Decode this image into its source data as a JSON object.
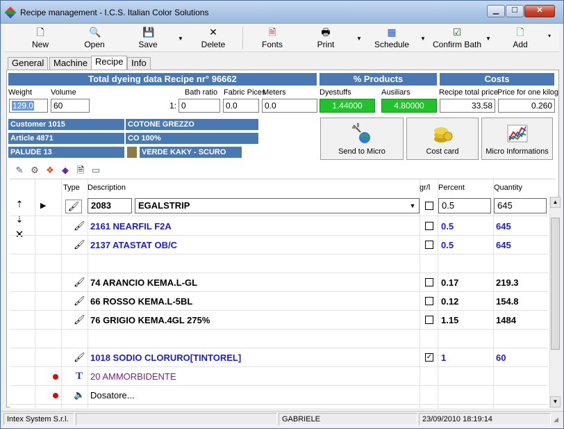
{
  "window": {
    "title": "Recipe management - I.C.S. Italian Color Solutions"
  },
  "toolbar": {
    "new": "New",
    "open": "Open",
    "save": "Save",
    "delete": "Delete",
    "fonts": "Fonts",
    "print": "Print",
    "schedule": "Schedule",
    "confirm_bath": "Confirm Bath",
    "add": "Add"
  },
  "tabs": [
    "General",
    "Machine",
    "Recipe",
    "Info"
  ],
  "headers": {
    "total": "Total dyeing data Recipe nr° 96662",
    "products": "% Products",
    "costs": "Costs"
  },
  "fields": {
    "weight_label": "Weight",
    "weight": "129.0",
    "volume_label": "Volume",
    "volume": "60",
    "bath_ratio_label": "Bath ratio",
    "bath_ratio_prefix": "1:",
    "bath_ratio": "0",
    "fabric_pieces_label": "Fabric Pices",
    "fabric_pieces": "0.0",
    "meters_label": "Meters",
    "meters": "0.0",
    "dyestuffs_label": "Dyestuffs",
    "dyestuffs": "1.44000",
    "ausiliars_label": "Ausiliars",
    "ausiliars": "4.80000",
    "recipe_total_price_label": "Recipe total price",
    "recipe_total_price": "33.58",
    "price_per_kg_label": "Price for one kilog",
    "price_per_kg": "0.260"
  },
  "info": {
    "customer": "Customer 1015",
    "customer_value": "COTONE GREZZO",
    "article": "Article 4871",
    "article_value": "CO 100%",
    "color": "PALUDE 13",
    "color_value": "VERDE KAKY - SCURO",
    "swatch_color": "#8b7b4a"
  },
  "actions": {
    "send_to_micro": "Send to Micro",
    "cost_card": "Cost card",
    "micro_informations": "Micro Informations"
  },
  "grid": {
    "headers": {
      "type": "Type",
      "description": "Description",
      "grl": "gr/l",
      "percent": "Percent",
      "quantity": "Quantity"
    },
    "edit_row": {
      "code": "2083",
      "name": "EGALSTRIP",
      "percent": "0.5",
      "quantity": "645"
    },
    "rows": [
      {
        "desc": "2161 NEARFIL F2A",
        "percent": "0.5",
        "quantity": "645",
        "checked": false,
        "color": "blue"
      },
      {
        "desc": "2137 ATASTAT OB/C",
        "percent": "0.5",
        "quantity": "645",
        "checked": false,
        "color": "blue"
      },
      {
        "desc": "74 ARANCIO KEMA.L-GL",
        "percent": "0.17",
        "quantity": "219.3",
        "checked": false,
        "color": "black"
      },
      {
        "desc": "66 ROSSO KEMA.L-5BL",
        "percent": "0.12",
        "quantity": "154.8",
        "checked": false,
        "color": "black"
      },
      {
        "desc": "76 GRIGIO KEMA.4GL 275%",
        "percent": "1.15",
        "quantity": "1484",
        "checked": false,
        "color": "black"
      },
      {
        "desc": "1018 SODIO CLORURO[TINTOREL]",
        "percent": "1",
        "quantity": "60",
        "checked": true,
        "color": "blue"
      },
      {
        "desc": "20 AMMORBIDENTE",
        "color": "purple"
      },
      {
        "desc": "Dosatore...",
        "color": "black"
      }
    ]
  },
  "status": {
    "company": "Intex System S.r.l.",
    "user": "GABRIELE",
    "datetime": "23/09/2010 18:19:14"
  }
}
